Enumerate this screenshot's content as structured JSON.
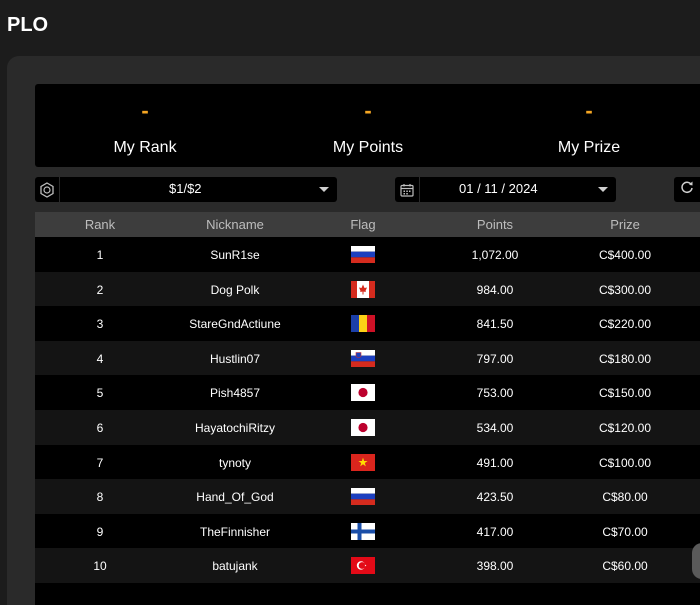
{
  "page": {
    "title": "PLO"
  },
  "summary": {
    "rank": {
      "value": "-",
      "label": "My Rank"
    },
    "points": {
      "value": "-",
      "label": "My Points"
    },
    "prize": {
      "value": "-",
      "label": "My Prize"
    }
  },
  "filters": {
    "stake": {
      "value": "$1/$2",
      "icon": "poker-chip-icon"
    },
    "date": {
      "value": "01 / 11 / 2024",
      "icon": "calendar-icon"
    },
    "refresh": {
      "icon": "refresh-icon"
    }
  },
  "table": {
    "columns": [
      "Rank",
      "Nickname",
      "Flag",
      "Points",
      "Prize"
    ],
    "rows": [
      {
        "rank": "1",
        "nickname": "SunR1se",
        "flag": "russia",
        "points": "1,072.00",
        "prize": "C$400.00"
      },
      {
        "rank": "2",
        "nickname": "Dog Polk",
        "flag": "canada",
        "points": "984.00",
        "prize": "C$300.00"
      },
      {
        "rank": "3",
        "nickname": "StareGndActiune",
        "flag": "romania",
        "points": "841.50",
        "prize": "C$220.00"
      },
      {
        "rank": "4",
        "nickname": "Hustlin07",
        "flag": "slovenia",
        "points": "797.00",
        "prize": "C$180.00"
      },
      {
        "rank": "5",
        "nickname": "Pish4857",
        "flag": "japan",
        "points": "753.00",
        "prize": "C$150.00"
      },
      {
        "rank": "6",
        "nickname": "HayatochiRitzy",
        "flag": "japan",
        "points": "534.00",
        "prize": "C$120.00"
      },
      {
        "rank": "7",
        "nickname": "tynoty",
        "flag": "vietnam",
        "points": "491.00",
        "prize": "C$100.00"
      },
      {
        "rank": "8",
        "nickname": "Hand_Of_God",
        "flag": "russia",
        "points": "423.50",
        "prize": "C$80.00"
      },
      {
        "rank": "9",
        "nickname": "TheFinnisher",
        "flag": "finland",
        "points": "417.00",
        "prize": "C$70.00"
      },
      {
        "rank": "10",
        "nickname": "batujank",
        "flag": "turkey",
        "points": "398.00",
        "prize": "C$60.00"
      }
    ]
  },
  "colors": {
    "accent": "#f5a623",
    "background": "#1c1c1c",
    "panel": "#2a2a2a"
  }
}
